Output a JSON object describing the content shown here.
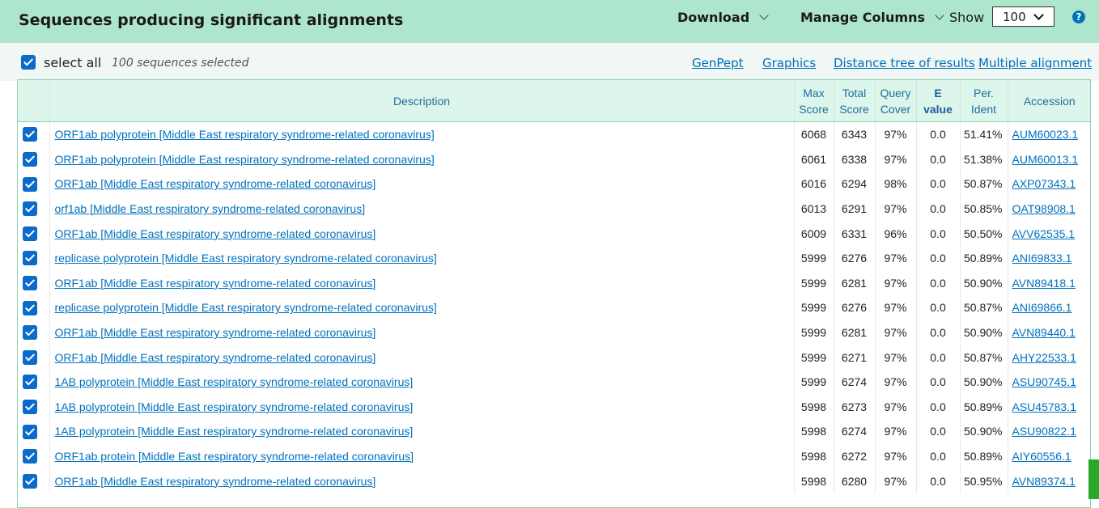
{
  "header": {
    "title": "Sequences producing significant alignments",
    "download_label": "Download",
    "manage_columns_label": "Manage Columns",
    "show_label": "Show",
    "show_value": "100",
    "help_glyph": "?"
  },
  "toolbar": {
    "select_all_label": "select all",
    "selected_count": "100 sequences selected",
    "links": {
      "genpept": "GenPept",
      "graphics": "Graphics",
      "distance_tree": "Distance tree of results",
      "multiple_alignment": "Multiple alignment"
    }
  },
  "table": {
    "headers": {
      "description": "Description",
      "max_score_1": "Max",
      "max_score_2": "Score",
      "total_score_1": "Total",
      "total_score_2": "Score",
      "query_cover_1": "Query",
      "query_cover_2": "Cover",
      "evalue_1": "E",
      "evalue_2": "value",
      "per_ident_1": "Per.",
      "per_ident_2": "Ident",
      "accession": "Accession"
    },
    "rows": [
      {
        "desc": "ORF1ab polyprotein [Middle East respiratory syndrome-related coronavirus]",
        "max": "6068",
        "total": "6343",
        "cover": "97%",
        "evalue": "0.0",
        "ident": "51.41%",
        "acc": "AUM60023.1"
      },
      {
        "desc": "ORF1ab polyprotein [Middle East respiratory syndrome-related coronavirus]",
        "max": "6061",
        "total": "6338",
        "cover": "97%",
        "evalue": "0.0",
        "ident": "51.38%",
        "acc": "AUM60013.1"
      },
      {
        "desc": "ORF1ab [Middle East respiratory syndrome-related coronavirus]",
        "max": "6016",
        "total": "6294",
        "cover": "98%",
        "evalue": "0.0",
        "ident": "50.87%",
        "acc": "AXP07343.1"
      },
      {
        "desc": "orf1ab [Middle East respiratory syndrome-related coronavirus]",
        "max": "6013",
        "total": "6291",
        "cover": "97%",
        "evalue": "0.0",
        "ident": "50.85%",
        "acc": "OAT98908.1"
      },
      {
        "desc": "ORF1ab [Middle East respiratory syndrome-related coronavirus]",
        "max": "6009",
        "total": "6331",
        "cover": "96%",
        "evalue": "0.0",
        "ident": "50.50%",
        "acc": "AVV62535.1"
      },
      {
        "desc": "replicase polyprotein [Middle East respiratory syndrome-related coronavirus]",
        "max": "5999",
        "total": "6276",
        "cover": "97%",
        "evalue": "0.0",
        "ident": "50.89%",
        "acc": "ANI69833.1"
      },
      {
        "desc": "ORF1ab [Middle East respiratory syndrome-related coronavirus]",
        "max": "5999",
        "total": "6281",
        "cover": "97%",
        "evalue": "0.0",
        "ident": "50.90%",
        "acc": "AVN89418.1"
      },
      {
        "desc": "replicase polyprotein [Middle East respiratory syndrome-related coronavirus]",
        "max": "5999",
        "total": "6276",
        "cover": "97%",
        "evalue": "0.0",
        "ident": "50.87%",
        "acc": "ANI69866.1"
      },
      {
        "desc": "ORF1ab [Middle East respiratory syndrome-related coronavirus]",
        "max": "5999",
        "total": "6281",
        "cover": "97%",
        "evalue": "0.0",
        "ident": "50.90%",
        "acc": "AVN89440.1"
      },
      {
        "desc": "ORF1ab [Middle East respiratory syndrome-related coronavirus]",
        "max": "5999",
        "total": "6271",
        "cover": "97%",
        "evalue": "0.0",
        "ident": "50.87%",
        "acc": "AHY22533.1"
      },
      {
        "desc": "1AB polyprotein [Middle East respiratory syndrome-related coronavirus]",
        "max": "5999",
        "total": "6274",
        "cover": "97%",
        "evalue": "0.0",
        "ident": "50.90%",
        "acc": "ASU90745.1"
      },
      {
        "desc": "1AB polyprotein [Middle East respiratory syndrome-related coronavirus]",
        "max": "5998",
        "total": "6273",
        "cover": "97%",
        "evalue": "0.0",
        "ident": "50.89%",
        "acc": "ASU45783.1"
      },
      {
        "desc": "1AB polyprotein [Middle East respiratory syndrome-related coronavirus]",
        "max": "5998",
        "total": "6274",
        "cover": "97%",
        "evalue": "0.0",
        "ident": "50.90%",
        "acc": "ASU90822.1"
      },
      {
        "desc": "ORF1ab protein [Middle East respiratory syndrome-related coronavirus]",
        "max": "5998",
        "total": "6272",
        "cover": "97%",
        "evalue": "0.0",
        "ident": "50.89%",
        "acc": "AIY60556.1"
      },
      {
        "desc": "ORF1ab [Middle East respiratory syndrome-related coronavirus]",
        "max": "5998",
        "total": "6280",
        "cover": "97%",
        "evalue": "0.0",
        "ident": "50.95%",
        "acc": "AVN89374.1"
      }
    ]
  },
  "colors": {
    "header_bg": "#ade6cd",
    "toolbar_bg": "#f1f7f4",
    "table_header_bg": "#ddf6ec",
    "link": "#0071bc",
    "checkbox": "#0b6bcb",
    "scrollbar": "#29a829"
  },
  "icons": {
    "checkbox": "checkbox-checked-icon",
    "help": "help-circle-icon",
    "dropdown": "chevron-down-icon"
  }
}
